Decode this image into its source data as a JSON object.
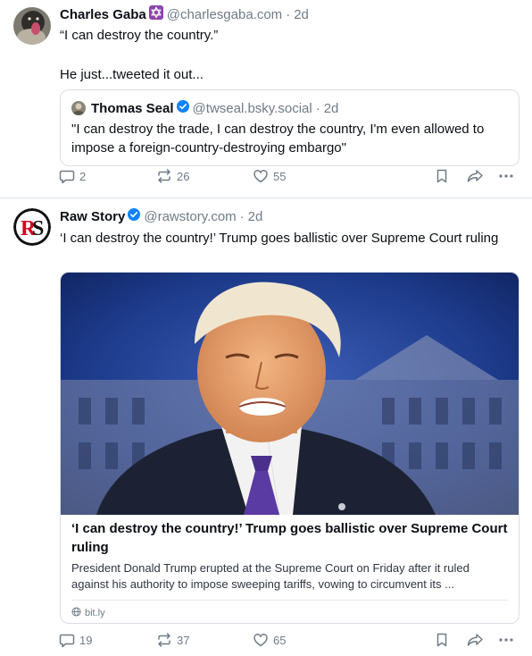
{
  "posts": [
    {
      "author": {
        "display_name": "Charles Gaba",
        "handle": "@charlesgaba.com",
        "badge_icon": "star-of-david-icon"
      },
      "time": "2d",
      "text": "“I can destroy the country.”\n\nHe just...tweeted it out...",
      "quote": {
        "author": {
          "display_name": "Thomas Seal",
          "handle": "@twseal.bsky.social",
          "verified": true
        },
        "time": "2d",
        "text": "\"I can destroy the trade, I can destroy the country, I'm even allowed to impose a foreign-country-destroying embargo\""
      },
      "actions": {
        "replies": "2",
        "reposts": "26",
        "likes": "55"
      }
    },
    {
      "author": {
        "display_name": "Raw Story",
        "handle": "@rawstory.com",
        "verified": true,
        "avatar_text": "RS"
      },
      "time": "2d",
      "text": "‘I can destroy the country!’ Trump goes ballistic over Supreme Court ruling",
      "link_card": {
        "title": "‘I can destroy the country!’ Trump goes ballistic over Supreme Court ruling",
        "description": "President Donald Trump erupted at the Supreme Court on Friday after it ruled against his authority to impose sweeping tariffs, vowing to circumvent its ...",
        "domain": "bit.ly"
      },
      "actions": {
        "replies": "19",
        "reposts": "37",
        "likes": "65"
      }
    }
  ],
  "colors": {
    "accent": "#1083fe",
    "muted": "#6f7b88",
    "border": "#d9dee5",
    "star_badge": "#8e44ad"
  }
}
